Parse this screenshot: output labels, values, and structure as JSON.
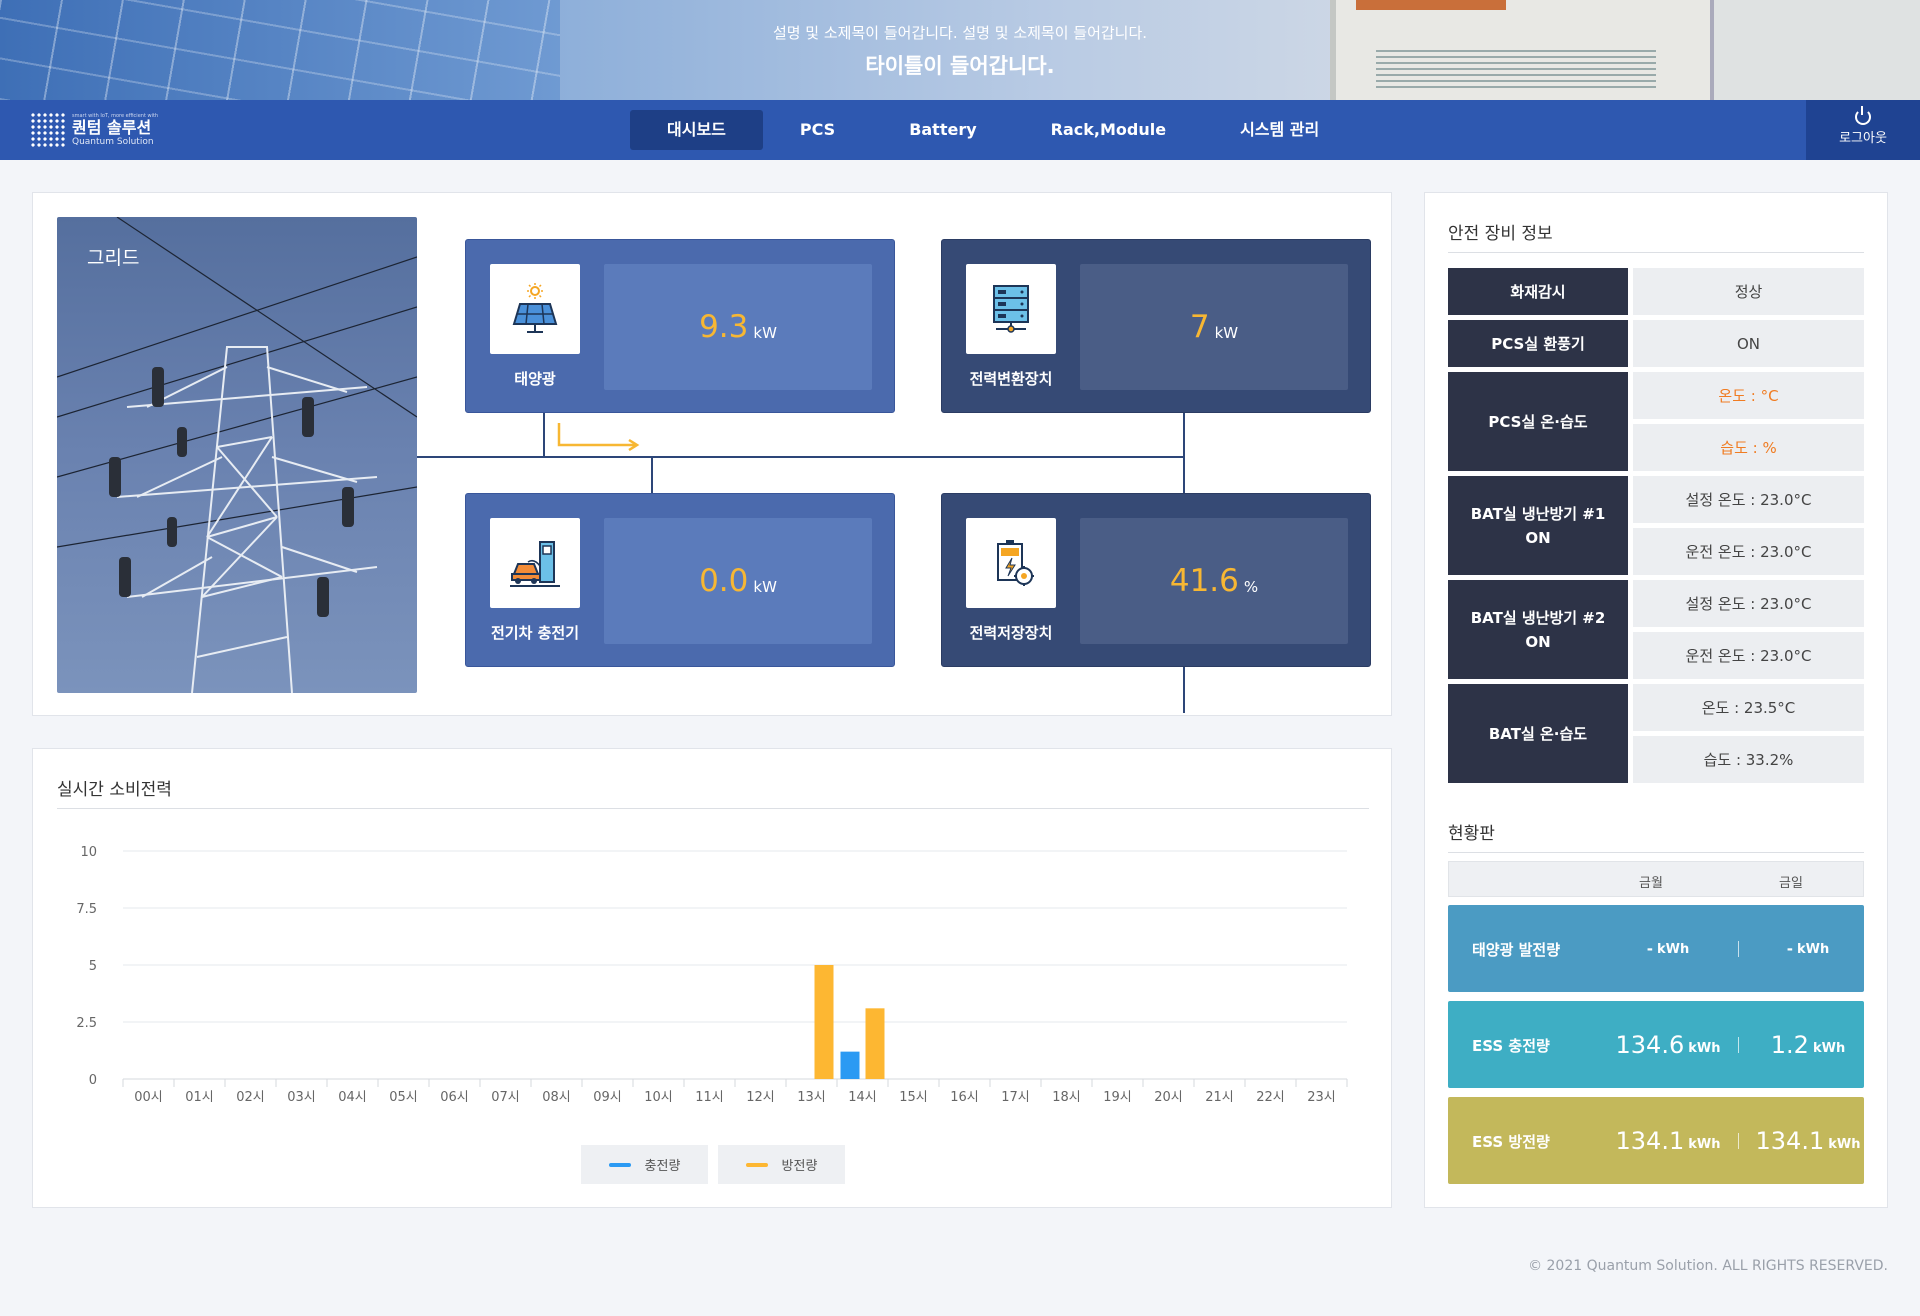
{
  "banner": {
    "subtitle": "설명 및 소제목이 들어갑니다. 설명 및 소제목이 들어갑니다.",
    "title": "타이틀이 들어갑니다."
  },
  "logo": {
    "tagline": "smart with IoT, more efficient with",
    "name_ko": "퀀텀 솔루션",
    "name_en": "Quantum Solution"
  },
  "nav": {
    "items": [
      "대시보드",
      "PCS",
      "Battery",
      "Rack,Module",
      "시스템 관리"
    ],
    "active": "대시보드",
    "logout": "로그아웃"
  },
  "grid": {
    "label": "그리드",
    "solar": {
      "label": "태양광",
      "value": "9.3",
      "unit": "kW",
      "icon": "solar-panel-icon"
    },
    "pcs": {
      "label": "전력변환장치",
      "value": "7",
      "unit": "kW",
      "icon": "server-rack-icon"
    },
    "ev": {
      "label": "전기차 충전기",
      "value": "0.0",
      "unit": "kW",
      "icon": "ev-charger-icon"
    },
    "ess": {
      "label": "전력저장장치",
      "value": "41.6",
      "unit": "%",
      "icon": "battery-icon"
    }
  },
  "chart_title": "실시간 소비전력",
  "chart_data": {
    "type": "bar",
    "categories": [
      "00시",
      "01시",
      "02시",
      "03시",
      "04시",
      "05시",
      "06시",
      "07시",
      "08시",
      "09시",
      "10시",
      "11시",
      "12시",
      "13시",
      "14시",
      "15시",
      "16시",
      "17시",
      "18시",
      "19시",
      "20시",
      "21시",
      "22시",
      "23시"
    ],
    "series": [
      {
        "name": "충전량",
        "color": "#2b9af3",
        "values": [
          0,
          0,
          0,
          0,
          0,
          0,
          0,
          0,
          0,
          0,
          0,
          0,
          0,
          0,
          1.2,
          0,
          0,
          0,
          0,
          0,
          0,
          0,
          0,
          0
        ]
      },
      {
        "name": "방전량",
        "color": "#fdb732",
        "values": [
          0,
          0,
          0,
          0,
          0,
          0,
          0,
          0,
          0,
          0,
          0,
          0,
          0,
          5.0,
          3.1,
          0,
          0,
          0,
          0,
          0,
          0,
          0,
          0,
          0
        ]
      }
    ],
    "yticks": [
      "10",
      "7.5",
      "5",
      "2.5",
      "0"
    ],
    "ylim": [
      0,
      10
    ],
    "grid": true,
    "legend": "bottom-center"
  },
  "safety": {
    "title": "안전 장비 정보",
    "fire": {
      "label": "화재감시",
      "value": "정상"
    },
    "vent": {
      "label": "PCS실 환풍기",
      "value": "ON"
    },
    "pcs_th": {
      "label": "PCS실 온·습도",
      "temp": "온도 : °C",
      "hum": "습도 : %"
    },
    "bat1": {
      "label": "BAT실 냉난방기 #1",
      "state": "ON",
      "set": "설정 온도 : 23.0°C",
      "run": "운전 온도 : 23.0°C"
    },
    "bat2": {
      "label": "BAT실 냉난방기 #2",
      "state": "ON",
      "set": "설정 온도 : 23.0°C",
      "run": "운전 온도 : 23.0°C"
    },
    "bat_th": {
      "label": "BAT실 온·습도",
      "temp": "온도 : 23.5°C",
      "hum": "습도 : 33.2%"
    }
  },
  "status": {
    "title": "현황판",
    "col1": "금월",
    "col2": "금일",
    "rows": [
      {
        "label": "태양광 발전량",
        "v1": "-",
        "v2": "-",
        "unit": "kWh",
        "color": "#4b9bc3"
      },
      {
        "label": "ESS 충전량",
        "v1": "134.6",
        "v2": "1.2",
        "unit": "kWh",
        "color": "#3eaec4"
      },
      {
        "label": "ESS 방전량",
        "v1": "134.1",
        "v2": "134.1",
        "unit": "kWh",
        "color": "#c3b85b"
      }
    ]
  },
  "footer": "© 2021 Quantum Solution. ALL RIGHTS RESERVED.",
  "colors": {
    "nav": "#2e58b0",
    "value": "#f7b733",
    "orange_text": "#f07c22"
  }
}
